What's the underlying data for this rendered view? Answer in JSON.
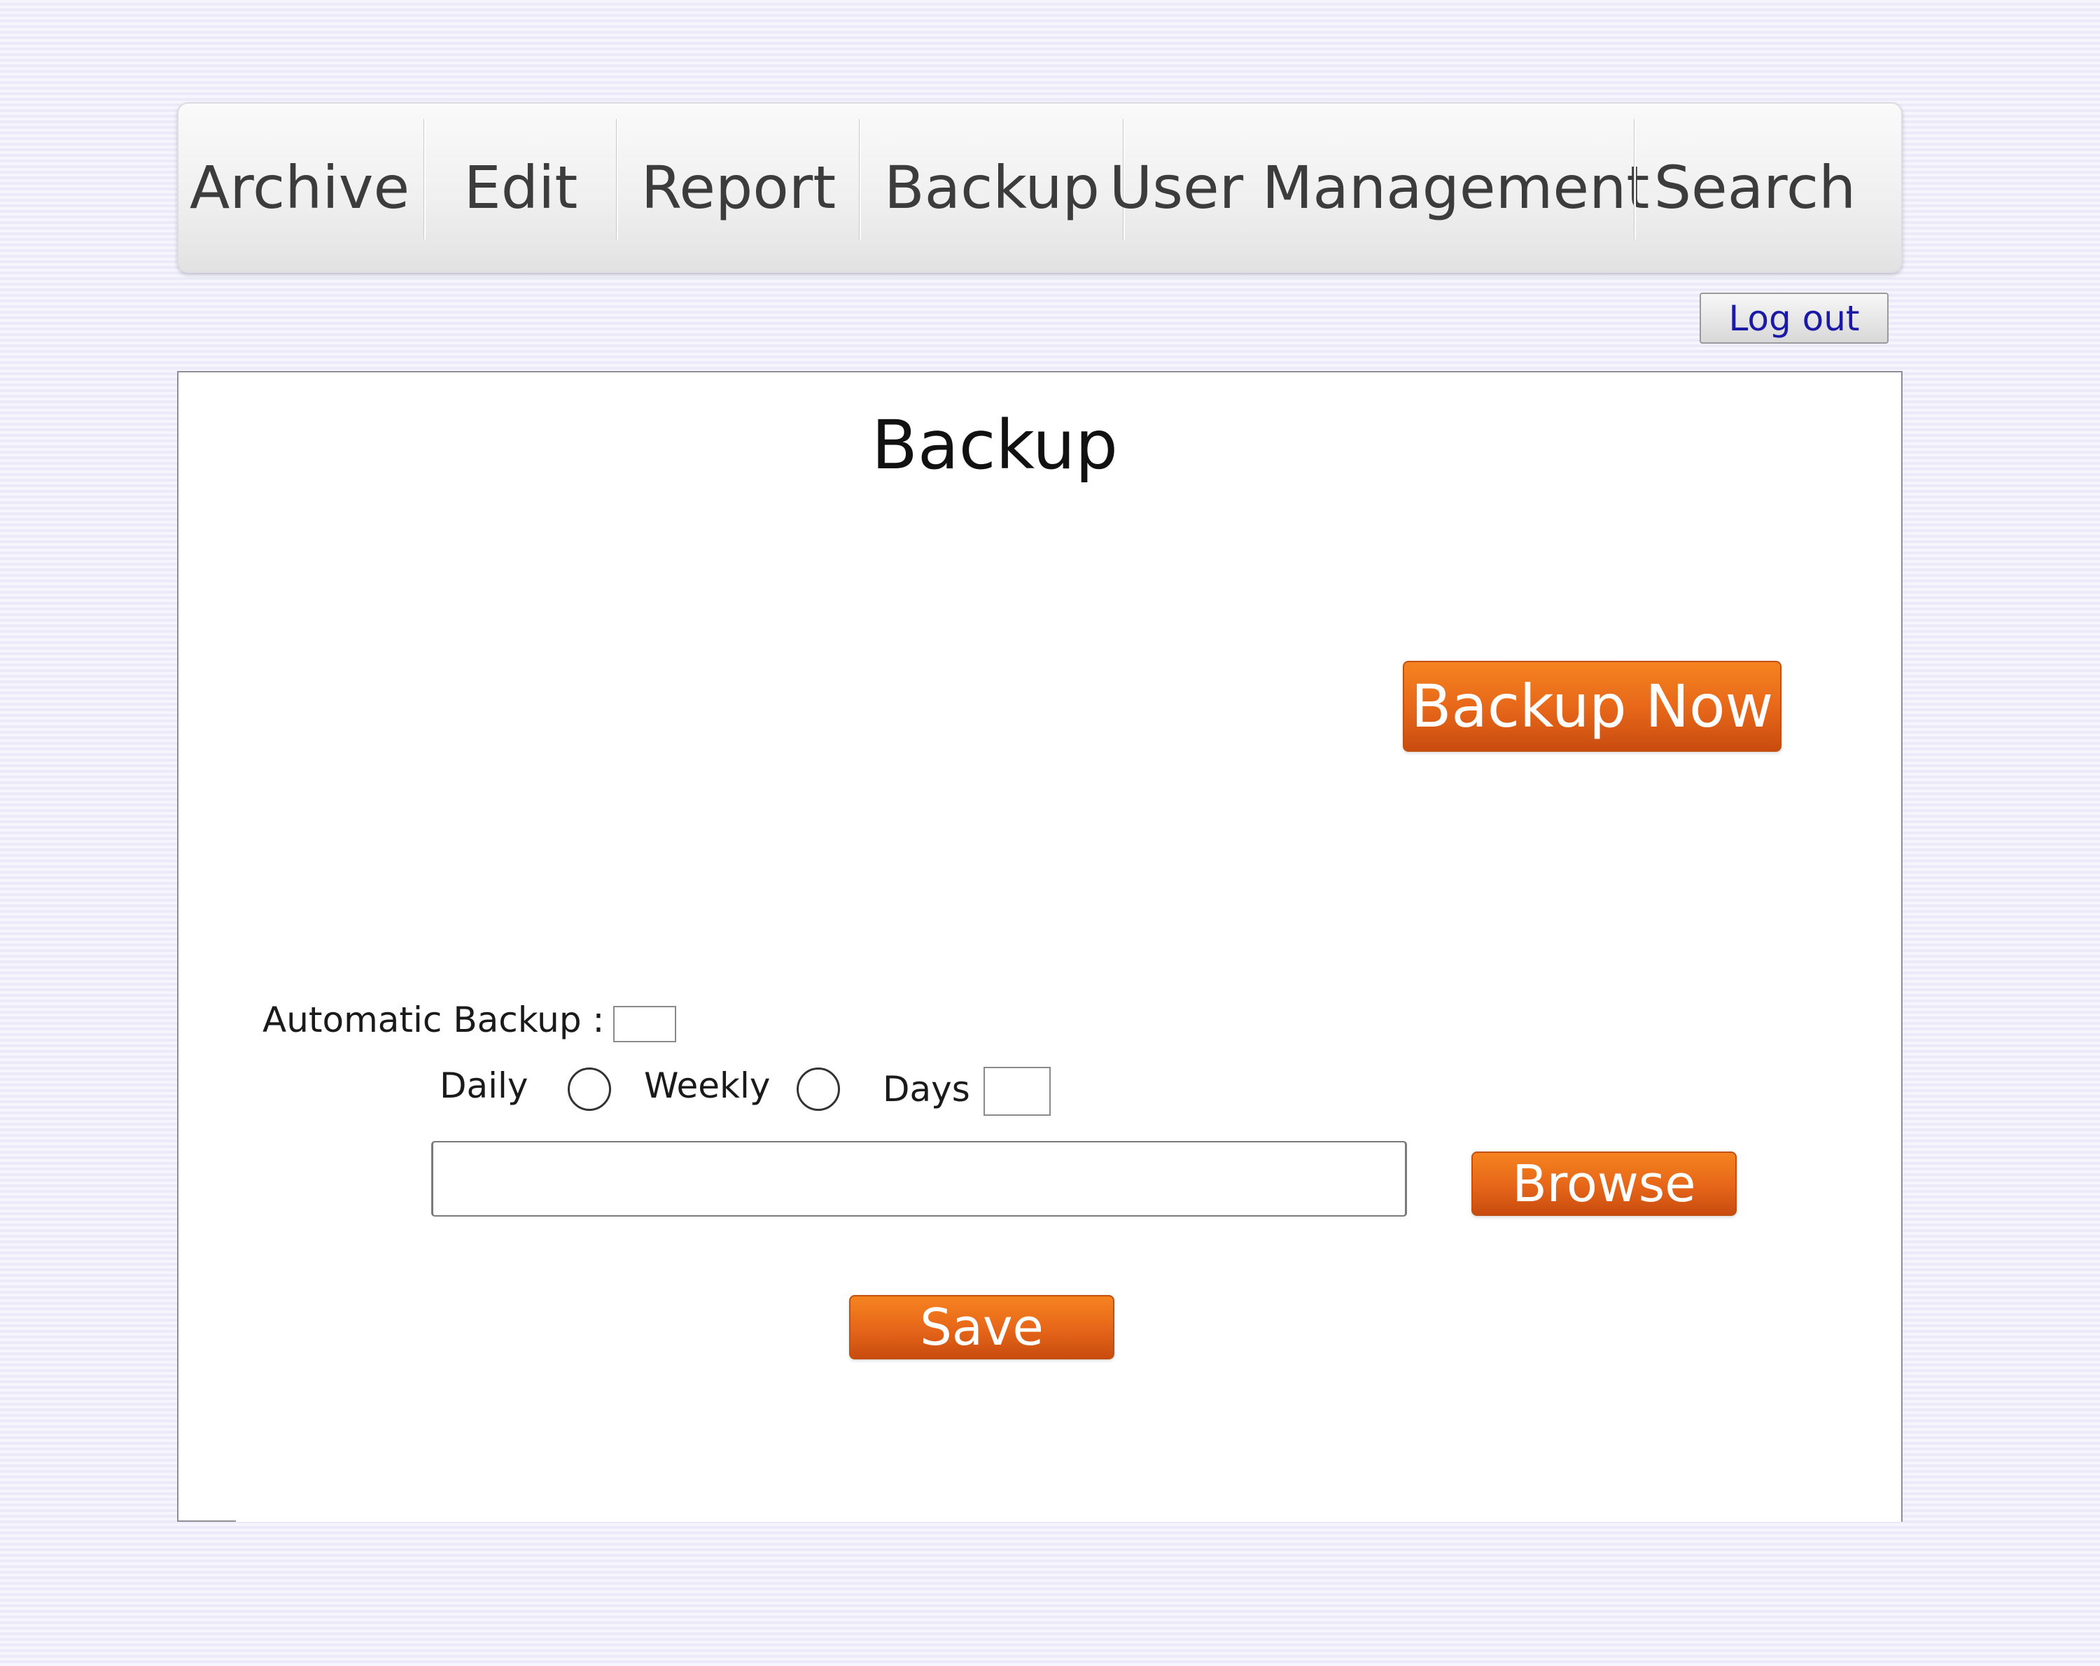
{
  "menu": {
    "items": [
      {
        "id": "archive",
        "label": "Archive"
      },
      {
        "id": "edit",
        "label": "Edit"
      },
      {
        "id": "report",
        "label": "Report"
      },
      {
        "id": "backup",
        "label": "Backup"
      },
      {
        "id": "user-management",
        "label": "User Management"
      },
      {
        "id": "search",
        "label": "Search"
      }
    ]
  },
  "header": {
    "logout_label": "Log out"
  },
  "main": {
    "title": "Backup",
    "backup_now_label": "Backup Now",
    "automatic_backup": {
      "label": "Automatic Backup :",
      "value": ""
    },
    "frequency": {
      "daily_label": "Daily",
      "daily_selected": false,
      "weekly_label": "Weekly",
      "weekly_selected": false,
      "days_label": "Days",
      "days_value": ""
    },
    "path": {
      "value": "",
      "placeholder": ""
    },
    "browse_label": "Browse",
    "save_label": "Save"
  },
  "colors": {
    "accent_orange": "#e8681a",
    "link_blue": "#1a1aa6",
    "background": "#f1f0fc"
  }
}
